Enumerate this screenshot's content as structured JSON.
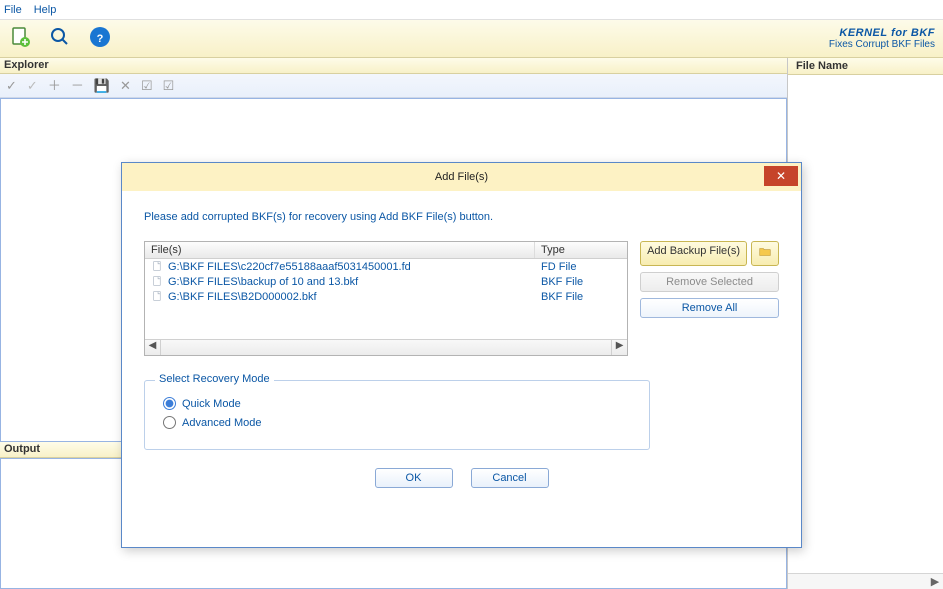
{
  "menu": {
    "file": "File",
    "help": "Help"
  },
  "brand": {
    "main_bold": "KERNEL",
    "main_rest": " for BKF",
    "sub": "Fixes Corrupt BKF Files"
  },
  "panes": {
    "explorer": "Explorer",
    "output": "Output",
    "file_name": "File Name"
  },
  "dialog": {
    "title": "Add File(s)",
    "instruction": "Please add corrupted BKF(s) for recovery using Add BKF File(s) button.",
    "cols": {
      "file": "File(s)",
      "type": "Type"
    },
    "files": [
      {
        "path": "G:\\BKF FILES\\c220cf7e55188aaaf5031450001.fd",
        "type": "FD File"
      },
      {
        "path": "G:\\BKF FILES\\backup of 10 and 13.bkf",
        "type": "BKF File"
      },
      {
        "path": "G:\\BKF FILES\\B2D000002.bkf",
        "type": "BKF File"
      }
    ],
    "btn_add": "Add Backup File(s)",
    "btn_remove_sel": "Remove Selected",
    "btn_remove_all": "Remove All",
    "fieldset_legend": "Select Recovery Mode",
    "radio_quick": "Quick Mode",
    "radio_advanced": "Advanced Mode",
    "ok": "OK",
    "cancel": "Cancel"
  }
}
